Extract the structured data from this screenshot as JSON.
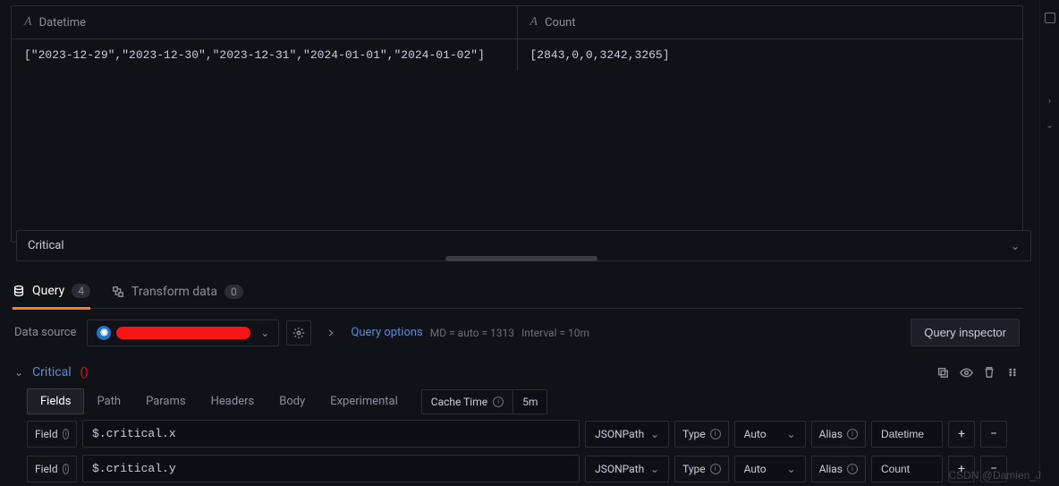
{
  "table": {
    "columns": [
      "Datetime",
      "Count"
    ],
    "row": {
      "datetime": "[\"2023-12-29\",\"2023-12-30\",\"2023-12-31\",\"2024-01-01\",\"2024-01-02\"]",
      "count": "[2843,0,0,3242,3265]"
    }
  },
  "query_name_box": "Critical",
  "tabs": {
    "query": {
      "label": "Query",
      "count": "4"
    },
    "transform": {
      "label": "Transform data",
      "count": "0"
    }
  },
  "datasource": {
    "label": "Data source",
    "query_options": "Query options",
    "md": "MD = auto = 1313",
    "interval": "Interval = 10m",
    "inspector": "Query inspector"
  },
  "query_block": {
    "name": "Critical",
    "subtabs": [
      "Fields",
      "Path",
      "Params",
      "Headers",
      "Body",
      "Experimental"
    ],
    "cache_label": "Cache Time",
    "cache_value": "5m",
    "fields": [
      {
        "label": "Field",
        "expr": "$.critical.x",
        "lang": "JSONPath",
        "type_lbl": "Type",
        "type": "Auto",
        "alias_lbl": "Alias",
        "alias": "Datetime"
      },
      {
        "label": "Field",
        "expr": "$.critical.y",
        "lang": "JSONPath",
        "type_lbl": "Type",
        "type": "Auto",
        "alias_lbl": "Alias",
        "alias": "Count"
      }
    ]
  },
  "watermark": "CSDN @Damien_J"
}
